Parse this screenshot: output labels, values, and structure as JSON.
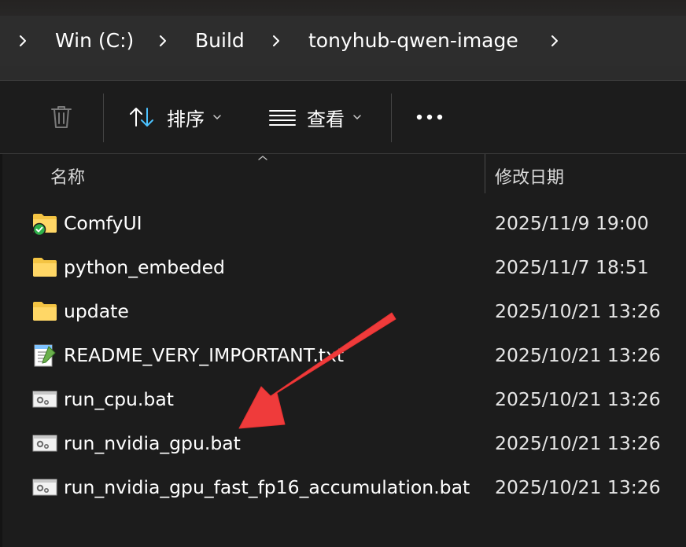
{
  "breadcrumb": {
    "items": [
      "Win (C:)",
      "Build",
      "tonyhub-qwen-image"
    ]
  },
  "toolbar": {
    "sort_label": "排序",
    "view_label": "查看"
  },
  "columns": {
    "name": "名称",
    "date": "修改日期"
  },
  "files": [
    {
      "name": "ComfyUI",
      "date": "2025/11/9 19:00",
      "icon": "folder-synced-icon"
    },
    {
      "name": "python_embeded",
      "date": "2025/11/7 18:51",
      "icon": "folder-icon"
    },
    {
      "name": "update",
      "date": "2025/10/21 13:26",
      "icon": "folder-icon"
    },
    {
      "name": "README_VERY_IMPORTANT.txt",
      "date": "2025/10/21 13:26",
      "icon": "notepad-file-icon"
    },
    {
      "name": "run_cpu.bat",
      "date": "2025/10/21 13:26",
      "icon": "batch-file-icon"
    },
    {
      "name": "run_nvidia_gpu.bat",
      "date": "2025/10/21 13:26",
      "icon": "batch-file-icon"
    },
    {
      "name": "run_nvidia_gpu_fast_fp16_accumulation.bat",
      "date": "2025/10/21 13:26",
      "icon": "batch-file-icon"
    }
  ],
  "colors": {
    "background": "#1c1c1c",
    "folder": "#f4c443",
    "sync_check": "#2fb24a",
    "arrow": "#ef3b3b"
  }
}
